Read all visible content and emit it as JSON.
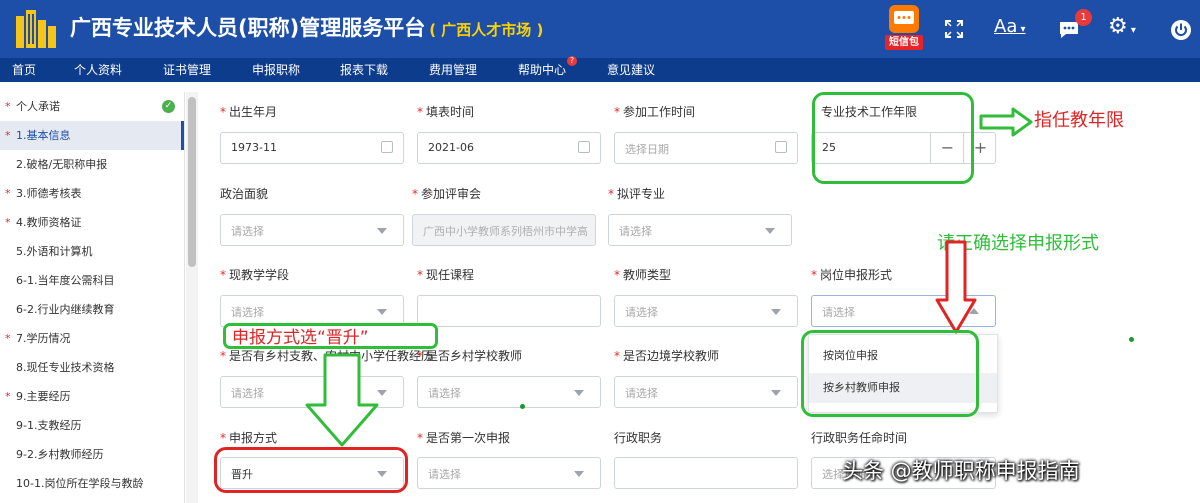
{
  "header": {
    "title": "广西专业技术人员(职称)管理服务平台",
    "subtitle": "( 广西人才市场 )",
    "sms_label": "短信包",
    "font_label": "Aa",
    "notification_count": "1"
  },
  "nav": {
    "items": [
      "首页",
      "个人资料",
      "证书管理",
      "申报职称",
      "报表下载",
      "费用管理",
      "帮助中心",
      "意见建议"
    ],
    "help_badge": "?"
  },
  "sidebar": {
    "items": [
      {
        "label": "个人承诺",
        "required": true
      },
      {
        "label": "1.基本信息",
        "required": true
      },
      {
        "label": "2.破格/无职称申报",
        "required": false
      },
      {
        "label": "3.师德考核表",
        "required": true
      },
      {
        "label": "4.教师资格证",
        "required": true
      },
      {
        "label": "5.外语和计算机",
        "required": false
      },
      {
        "label": "6-1.当年度公需科目",
        "required": false
      },
      {
        "label": "6-2.行业内继续教育",
        "required": false
      },
      {
        "label": "7.学历情况",
        "required": true
      },
      {
        "label": "8.现任专业技术资格",
        "required": false
      },
      {
        "label": "9.主要经历",
        "required": true
      },
      {
        "label": "9-1.支教经历",
        "required": false
      },
      {
        "label": "9-2.乡村教师经历",
        "required": false
      },
      {
        "label": "10-1.岗位所在学段与教龄",
        "required": false
      }
    ]
  },
  "form": {
    "birth_month": {
      "label": "出生年月",
      "value": "1973-11"
    },
    "fill_time": {
      "label": "填表时间",
      "value": "2021-06"
    },
    "work_start": {
      "label": "参加工作时间",
      "placeholder": "选择日期"
    },
    "pro_years": {
      "label": "专业技术工作年限",
      "value": "25"
    },
    "political": {
      "label": "政治面貌",
      "placeholder": "请选择"
    },
    "review_committee": {
      "label": "参加评审会",
      "value": "广西中小学教师系列梧州市中学高"
    },
    "major": {
      "label": "拟评专业",
      "placeholder": "请选择"
    },
    "teaching_stage": {
      "label": "现教学学段",
      "placeholder": "请选择"
    },
    "current_course": {
      "label": "现任课程",
      "value": ""
    },
    "teacher_type": {
      "label": "教师类型",
      "placeholder": "请选择"
    },
    "post_form": {
      "label": "岗位申报形式",
      "placeholder": "请选择",
      "options": [
        "按岗位申报",
        "按乡村教师申报"
      ]
    },
    "rural_exp": {
      "label": "是否有乡村支教、农村中小学任教经历",
      "placeholder": "请选择"
    },
    "rural_teacher": {
      "label": "是否乡村学校教师",
      "placeholder": "请选择"
    },
    "border_teacher": {
      "label": "是否边境学校教师",
      "placeholder": "请选择"
    },
    "apply_method": {
      "label": "申报方式",
      "value": "晋升"
    },
    "first_apply": {
      "label": "是否第一次申报",
      "placeholder": "请选择"
    },
    "admin_post": {
      "label": "行政职务",
      "value": ""
    },
    "admin_post_time": {
      "label": "行政职务任命时间",
      "placeholder": "选择日期"
    }
  },
  "annotations": {
    "teaching_years": "指任教年限",
    "select_form": "请正确选择申报形式",
    "method_tip": "申报方式选“晋升”"
  },
  "watermark": "头条 @教师职称申报指南",
  "colors": {
    "header_bg": "#1d4fa8",
    "nav_bg": "#0e3c8d",
    "required": "#e02e2e",
    "green": "#2fbd3a",
    "red": "#e02424"
  }
}
